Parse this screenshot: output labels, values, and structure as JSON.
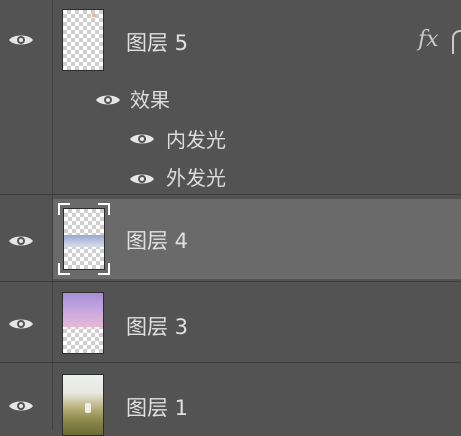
{
  "layers_panel": {
    "layers": [
      {
        "name": "图层 5",
        "visible": true,
        "has_fx": true,
        "fx_label": "fx",
        "effects_label": "效果",
        "effects": [
          "内发光",
          "外发光"
        ]
      },
      {
        "name": "图层 4",
        "visible": true,
        "selected": true
      },
      {
        "name": "图层 3",
        "visible": true
      },
      {
        "name": "图层 1",
        "visible": true
      }
    ]
  },
  "colors": {
    "panel_bg": "#535353",
    "selected_row_bg": "#6a6a6a",
    "text": "#e0e0e0",
    "separator": "#3c3c3c"
  },
  "icons": {
    "visibility": "eye-icon",
    "effects": "fx-icon"
  }
}
